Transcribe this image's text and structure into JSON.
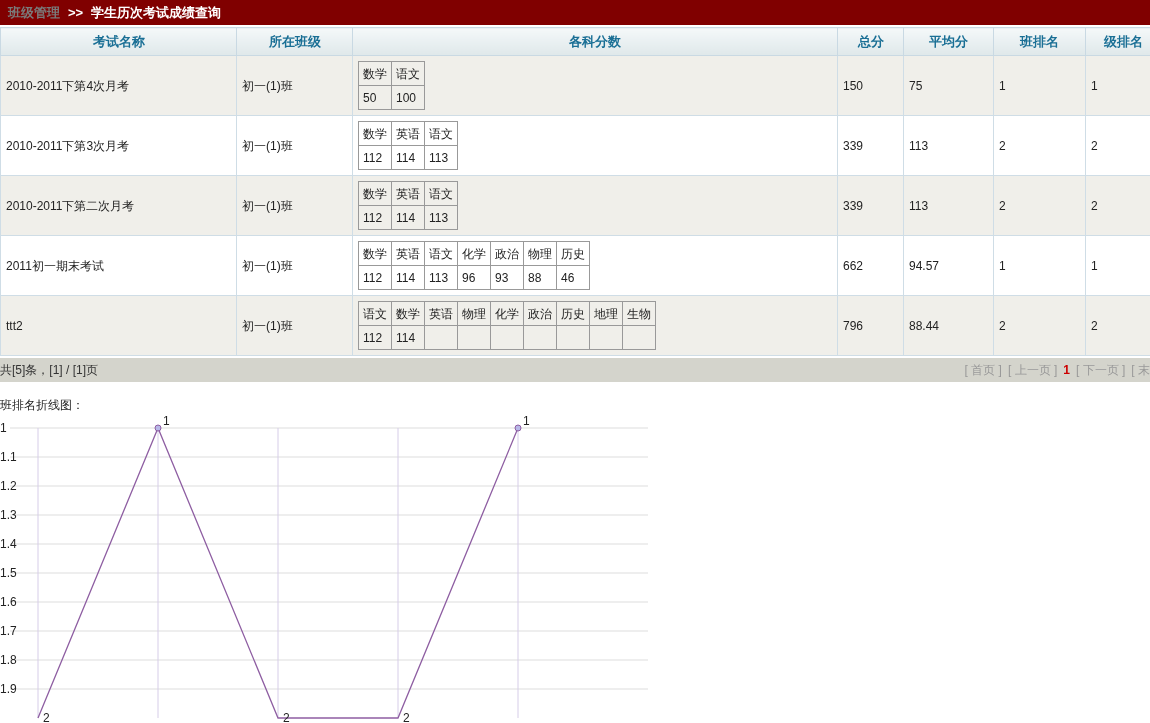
{
  "breadcrumb": {
    "section": "班级管理",
    "separator": ">>",
    "title": "学生历次考试成绩查询"
  },
  "table": {
    "columns": [
      "考试名称",
      "所在班级",
      "各科分数",
      "总分",
      "平均分",
      "班排名",
      "级排名"
    ],
    "rows": [
      {
        "exam": "2010-2011下第4次月考",
        "class": "初一(1)班",
        "subjects": [
          "数学",
          "语文"
        ],
        "scores": [
          "50",
          "100"
        ],
        "total": "150",
        "average": "75",
        "class_rank": "1",
        "grade_rank": "1"
      },
      {
        "exam": "2010-2011下第3次月考",
        "class": "初一(1)班",
        "subjects": [
          "数学",
          "英语",
          "语文"
        ],
        "scores": [
          "112",
          "114",
          "113"
        ],
        "total": "339",
        "average": "113",
        "class_rank": "2",
        "grade_rank": "2"
      },
      {
        "exam": "2010-2011下第二次月考",
        "class": "初一(1)班",
        "subjects": [
          "数学",
          "英语",
          "语文"
        ],
        "scores": [
          "112",
          "114",
          "113"
        ],
        "total": "339",
        "average": "113",
        "class_rank": "2",
        "grade_rank": "2"
      },
      {
        "exam": "2011初一期末考试",
        "class": "初一(1)班",
        "subjects": [
          "数学",
          "英语",
          "语文",
          "化学",
          "政治",
          "物理",
          "历史"
        ],
        "scores": [
          "112",
          "114",
          "113",
          "96",
          "93",
          "88",
          "46"
        ],
        "total": "662",
        "average": "94.57",
        "class_rank": "1",
        "grade_rank": "1"
      },
      {
        "exam": "ttt2",
        "class": "初一(1)班",
        "subjects": [
          "语文",
          "数学",
          "英语",
          "物理",
          "化学",
          "政治",
          "历史",
          "地理",
          "生物"
        ],
        "scores": [
          "112",
          "114"
        ],
        "total": "796",
        "average": "88.44",
        "class_rank": "2",
        "grade_rank": "2"
      }
    ]
  },
  "pager": {
    "summary": "共[5]条，[1] / [1]页",
    "links": [
      {
        "label": "[ 首页 ]",
        "selected": false
      },
      {
        "label": "[ 上一页 ]",
        "selected": false
      },
      {
        "label": "1",
        "selected": true
      },
      {
        "label": "[ 下一页 ]",
        "selected": false
      },
      {
        "label": "[ 末",
        "selected": false
      }
    ]
  },
  "chart": {
    "title": "班排名折线图：",
    "chart_data": {
      "type": "line",
      "series": [
        {
          "color": "#8e5ea2",
          "values": [
            2,
            1,
            2,
            2,
            1
          ]
        }
      ],
      "ylim": [
        2,
        1
      ],
      "grid": true,
      "yticks": [
        1,
        1.1,
        1.2,
        1.3,
        1.4,
        1.5,
        1.6,
        1.7,
        1.8,
        1.9
      ],
      "data_labels": true
    }
  }
}
